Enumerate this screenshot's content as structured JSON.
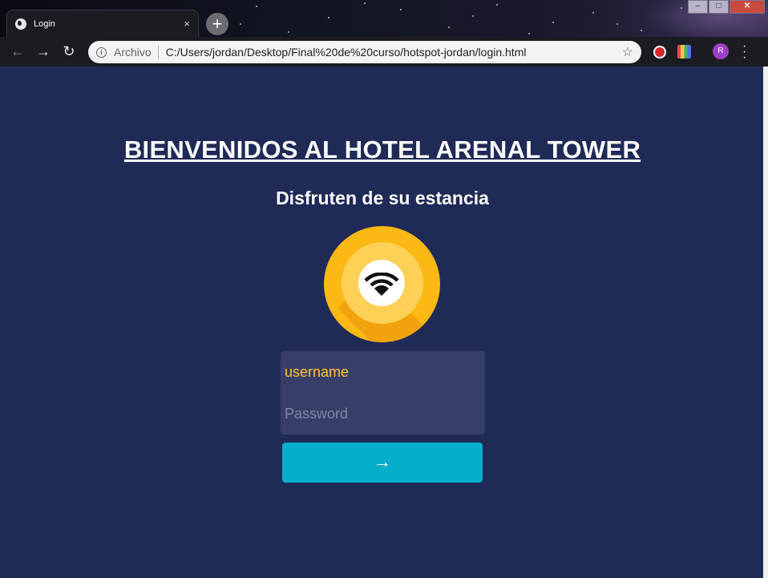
{
  "browser": {
    "tab_title": "Login",
    "tab_close": "×",
    "new_tab": "+",
    "address_scheme": "Archivo",
    "address_url": "C:/Users/jordan/Desktop/Final%20de%20curso/hotspot-jordan/login.html",
    "profile_initial": "R",
    "icons": {
      "back": "back-arrow-icon",
      "forward": "forward-arrow-icon",
      "reload": "reload-icon",
      "info": "info-icon",
      "bookmark": "star-icon",
      "menu": "more-vert-icon"
    }
  },
  "page": {
    "headline": "BIENVENIDOS AL HOTEL ARENAL TOWER",
    "subheadline": "Disfruten de su estancia",
    "username_field": "username",
    "password_placeholder": "Password",
    "submit_label": "→",
    "colors": {
      "background": "#1f2a57",
      "field_bg": "#373f68",
      "username_text": "#fcc33a",
      "button": "#03aecb",
      "logo": "#fcb813"
    }
  }
}
